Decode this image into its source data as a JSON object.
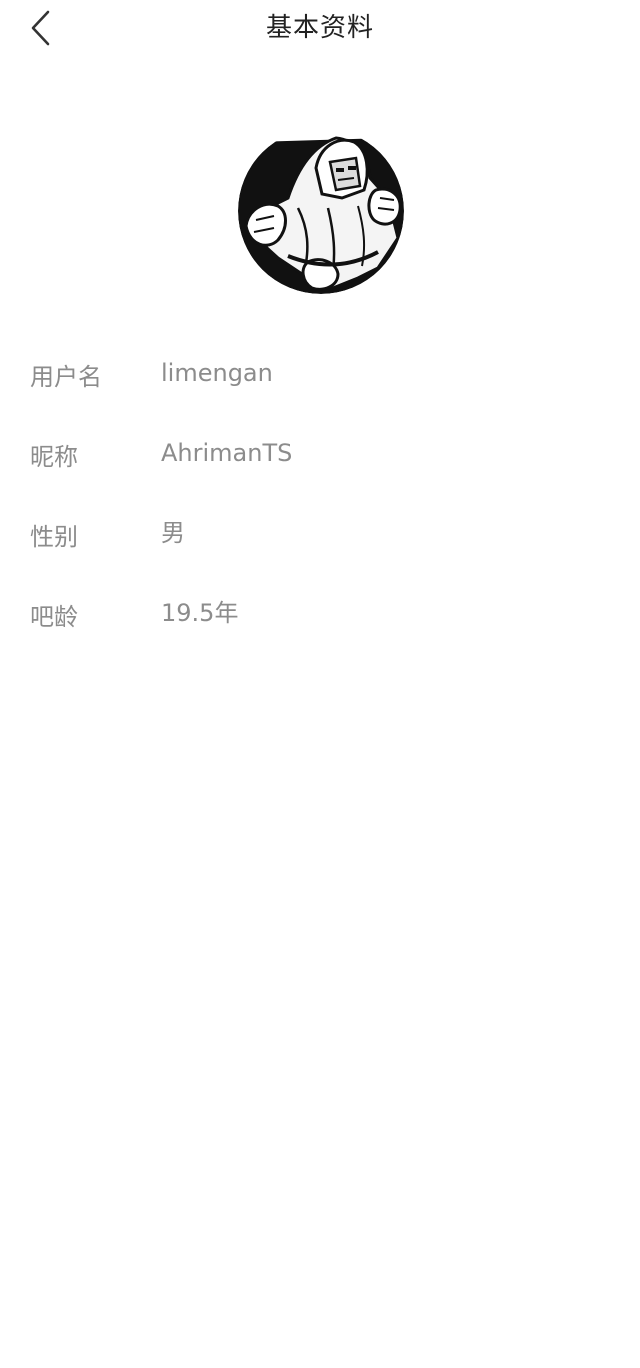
{
  "header": {
    "back_icon": "chevron-left-icon",
    "title": "基本资料"
  },
  "avatar": {
    "icon": "avatar-image"
  },
  "profile": {
    "rows": [
      {
        "label": "用户名",
        "value": "limengan"
      },
      {
        "label": "昵称",
        "value": "AhrimanTS"
      },
      {
        "label": "性别",
        "value": "男"
      },
      {
        "label": "吧龄",
        "value": "19.5年"
      }
    ]
  },
  "colors": {
    "text_primary": "#222222",
    "text_secondary": "#8c8c8c",
    "background": "#ffffff"
  }
}
